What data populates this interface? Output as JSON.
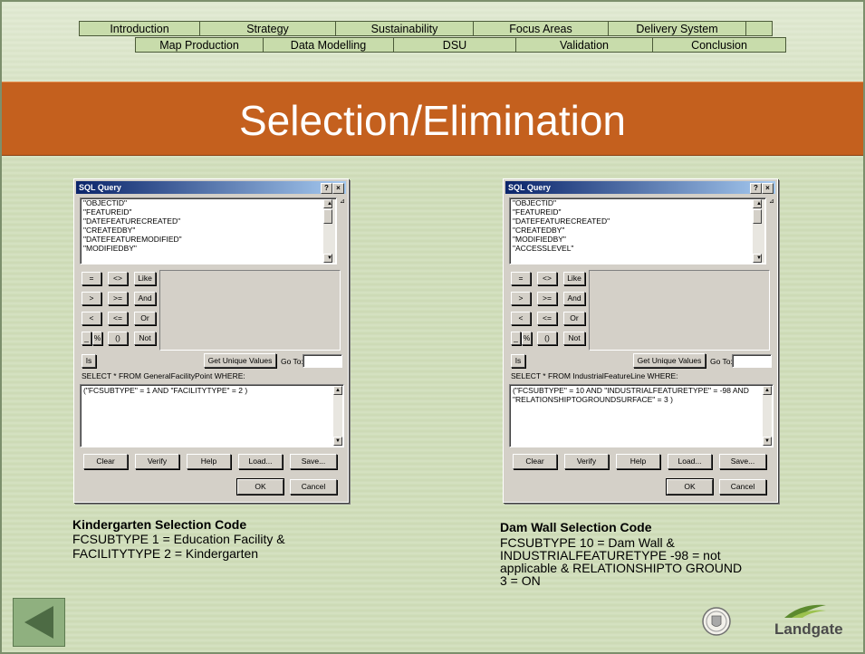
{
  "nav": {
    "row1": [
      "Introduction",
      "Strategy",
      "Sustainability",
      "Focus Areas",
      "Delivery System",
      ""
    ],
    "row2": [
      "Map Production",
      "Data Modelling",
      "DSU",
      "Validation",
      "Conclusion"
    ]
  },
  "title": "Selection/Elimination",
  "dialogs": [
    {
      "window_title": "SQL Query",
      "help_glyph": "?",
      "close_glyph": "×",
      "fields": [
        "\"OBJECTID\"",
        "\"FEATUREID\"",
        "\"DATEFEATURECREATED\"",
        "\"CREATEDBY\"",
        "\"DATEFEATUREMODIFIED\"",
        "\"MODIFIEDBY\""
      ],
      "operators": [
        "=",
        "<>",
        "Like",
        ">",
        ">=",
        "And",
        "<",
        "<=",
        "Or",
        "_",
        "%",
        "()",
        "Not",
        "Is"
      ],
      "get_unique_values": "Get Unique Values",
      "go_to_label": "Go To:",
      "select_label": "SELECT * FROM GeneralFacilityPoint WHERE:",
      "expression": "(\"FCSUBTYPE\" = 1 AND \"FACILITYTYPE\" = 2 )",
      "buttons": [
        "Clear",
        "Verify",
        "Help",
        "Load...",
        "Save..."
      ],
      "ok": "OK",
      "cancel": "Cancel"
    },
    {
      "window_title": "SQL Query",
      "help_glyph": "?",
      "close_glyph": "×",
      "fields": [
        "\"OBJECTID\"",
        "\"FEATUREID\"",
        "\"DATEFEATURECREATED\"",
        "\"CREATEDBY\"",
        "\"MODIFIEDBY\"",
        "\"ACCESSLEVEL\""
      ],
      "operators": [
        "=",
        "<>",
        "Like",
        ">",
        ">=",
        "And",
        "<",
        "<=",
        "Or",
        "_",
        "%",
        "()",
        "Not",
        "Is"
      ],
      "get_unique_values": "Get Unique Values",
      "go_to_label": "Go To:",
      "select_label": "SELECT * FROM IndustrialFeatureLine WHERE:",
      "expression": "(\"FCSUBTYPE\" = 10 AND \"INDUSTRIALFEATURETYPE\" = -98 AND \"RELATIONSHIPTOGROUNDSURFACE\" = 3 )",
      "buttons": [
        "Clear",
        "Verify",
        "Help",
        "Load...",
        "Save..."
      ],
      "ok": "OK",
      "cancel": "Cancel"
    }
  ],
  "captions": {
    "left": {
      "heading": "Kindergarten Selection Code",
      "line1": "FCSUBTYPE 1 = Education Facility &",
      "line2": "FACILITYTYPE 2 = Kindergarten"
    },
    "right": {
      "heading": "Dam Wall Selection Code",
      "line1": "FCSUBTYPE 10 = Dam Wall &",
      "line2": "INDUSTRIALFEATURETYPE -98 = not",
      "line3": "applicable & RELATIONSHIPTO GROUND",
      "line4": "3 = ON"
    }
  },
  "logo": "Landgate",
  "colors": {
    "title_band": "#c4601e",
    "nav_tab": "#c8dcab",
    "back_button": "#8fb07f"
  }
}
